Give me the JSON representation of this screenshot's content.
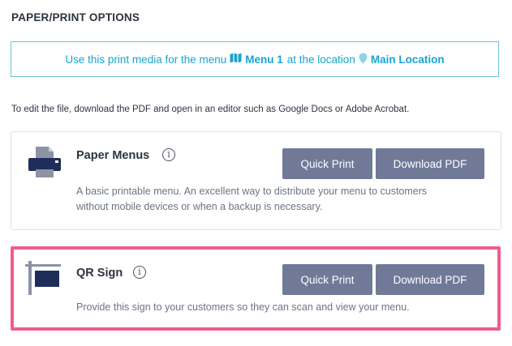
{
  "section_title": "PAPER/PRINT OPTIONS",
  "notice": {
    "prefix": "Use this print media for the menu",
    "menu_name": "Menu 1",
    "middle": "at the location",
    "location_name": "Main Location"
  },
  "helper_text": "To edit the file, download the PDF and open in an editor such as Google Docs or Adobe Acrobat.",
  "cards": [
    {
      "title": "Paper Menus",
      "info": "i",
      "quick_print": "Quick Print",
      "download_pdf": "Download PDF",
      "description_line1": "A basic printable menu. An excellent way to distribute your menu to customers",
      "description_line2": "without mobile devices or when a backup is necessary."
    },
    {
      "title": "QR Sign",
      "info": "i",
      "quick_print": "Quick Print",
      "download_pdf": "Download PDF",
      "description_line1": "Provide this sign to your customers so they can scan and view your menu."
    }
  ],
  "colors": {
    "accent_text": "#1aa3cf",
    "button": "#707a98",
    "highlight_border": "#ee5d8d",
    "notice_border": "#6cc3d8"
  },
  "icons": [
    "map-icon",
    "map-pin-icon",
    "printer-icon",
    "sign-post-icon",
    "info-icon"
  ]
}
